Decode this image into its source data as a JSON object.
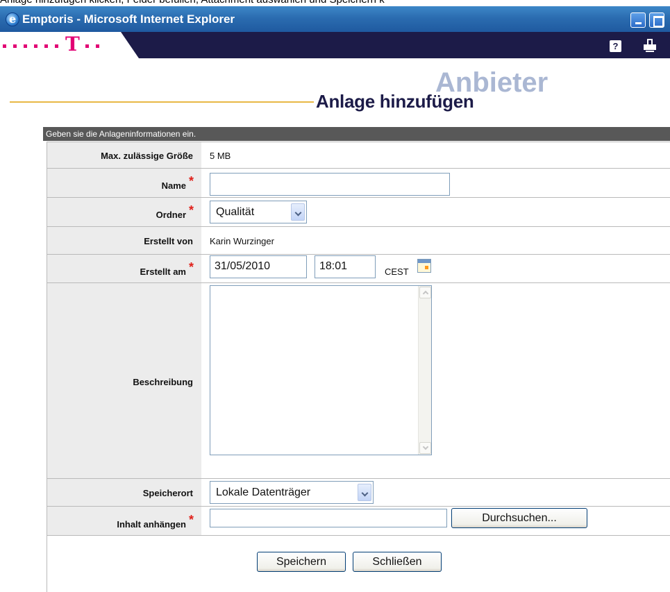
{
  "caption": "Anlage hinzufügen klicken, Felder befüllen, Attachment auswählen und Speichern k",
  "window": {
    "title": "Emptoris - Microsoft Internet Explorer"
  },
  "brand": {
    "help_label": "?"
  },
  "header": {
    "section": "Anbieter",
    "title": "Anlage hinzufügen"
  },
  "info": "Geben sie die Anlageninformationen ein.",
  "form": {
    "max_size": {
      "label": "Max. zulässige Größe",
      "value": "5 MB"
    },
    "name": {
      "label": "Name",
      "value": ""
    },
    "folder": {
      "label": "Ordner",
      "value": "Qualität"
    },
    "created_by": {
      "label": "Erstellt von",
      "value": "Karin Wurzinger"
    },
    "created_at": {
      "label": "Erstellt am",
      "date": "31/05/2010",
      "time": "18:01",
      "tz": "CEST"
    },
    "description": {
      "label": "Beschreibung",
      "value": ""
    },
    "storage": {
      "label": "Speicherort",
      "value": "Lokale Datenträger"
    },
    "attach": {
      "label": "Inhalt anhängen",
      "value": "",
      "browse": "Durchsuchen..."
    }
  },
  "actions": {
    "save": "Speichern",
    "close": "Schließen"
  },
  "colors": {
    "brand_magenta": "#e20074",
    "brand_navy": "#1c1b48",
    "required": "#e0201a",
    "label_bg": "#ececec"
  }
}
